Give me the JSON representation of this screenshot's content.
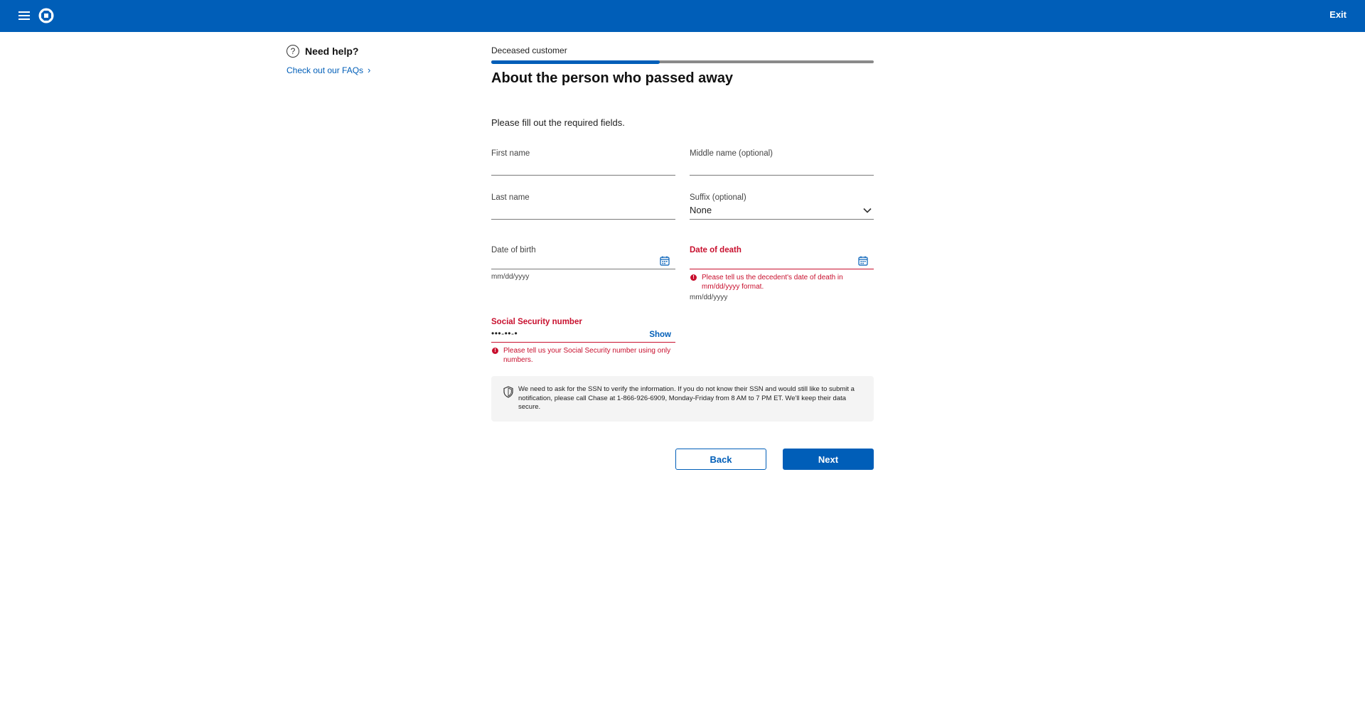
{
  "header": {
    "exit_label": "Exit",
    "brand_color": "#005eb8",
    "icons": [
      "hamburger-menu-icon",
      "chase-logo"
    ]
  },
  "help": {
    "title": "Need help?",
    "icon_glyph": "?",
    "faq_link": "Check out our FAQs",
    "faq_chevron": "›"
  },
  "main": {
    "eyebrow": "Deceased customer",
    "progress_fraction": 0.44,
    "title": "About the person who passed away",
    "instruction": "Please fill out the required fields."
  },
  "form": {
    "first_name": {
      "label": "First name",
      "value": ""
    },
    "middle_name": {
      "label": "Middle name (optional)",
      "value": ""
    },
    "last_name": {
      "label": "Last name",
      "value": ""
    },
    "suffix": {
      "label": "Suffix (optional)",
      "value": "None"
    },
    "dob": {
      "label": "Date of birth",
      "helper": "mm/dd/yyyy",
      "value": ""
    },
    "dod": {
      "label": "Date of death",
      "error": "Please tell us the decedent's date of death in mm/dd/yyyy format.",
      "helper": "mm/dd/yyyy",
      "value": ""
    },
    "ssn": {
      "label": "Social Security number",
      "value": "•••-••-•",
      "show_label": "Show",
      "error": "Please tell us your Social Security number using only numbers."
    },
    "error_glyph": "!",
    "error_color": "#c8102e"
  },
  "notice": {
    "text": "We need to ask for the SSN to verify the information. If you do not know their SSN and would still like to submit a notification, please call Chase at 1-866-926-6909, Monday-Friday from 8 AM to 7 PM ET. We'll keep their data secure."
  },
  "buttons": {
    "back": "Back",
    "next": "Next"
  }
}
